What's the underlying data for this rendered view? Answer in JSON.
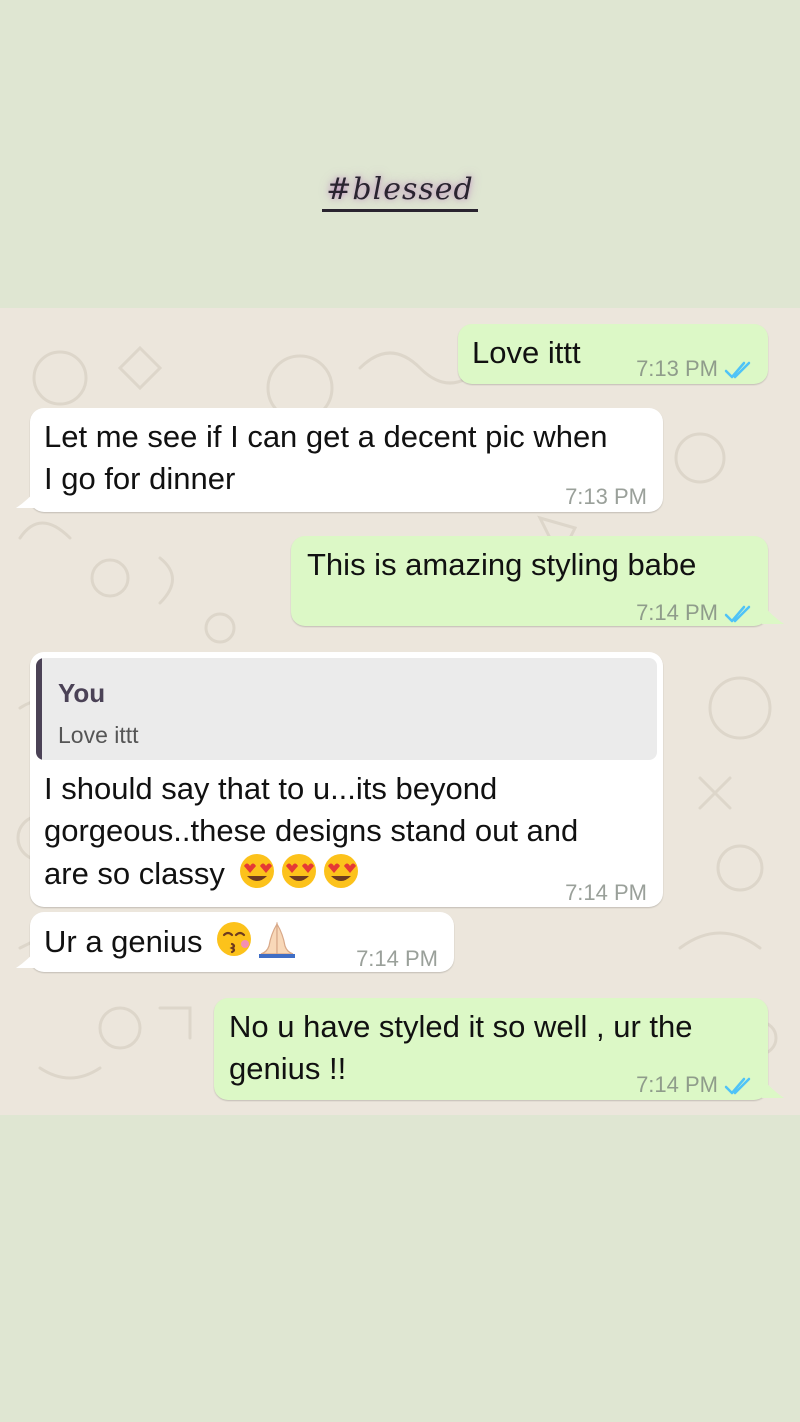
{
  "story": {
    "caption": "#blessed",
    "colors": {
      "background": "#dfe6d2"
    }
  },
  "chat": {
    "colors": {
      "outgoing_bubble": "#dcf8c6",
      "incoming_bubble": "#ffffff",
      "wallpaper": "#ece6dc",
      "read_ticks": "#4fc3f7"
    },
    "messages": [
      {
        "direction": "outgoing",
        "text": "Love ittt",
        "time": "7:13 PM",
        "status": "read-ticks-icon"
      },
      {
        "direction": "incoming",
        "text_line1": "Let me see if I can get a decent pic when",
        "text_line2": "I go for dinner",
        "time": "7:13 PM"
      },
      {
        "direction": "outgoing",
        "text": "This is amazing styling babe",
        "time": "7:14 PM",
        "status": "read-ticks-icon"
      },
      {
        "direction": "incoming",
        "quoted": {
          "author": "You",
          "text": "Love ittt"
        },
        "text_line1": "I should say that to u...its beyond",
        "text_line2": "gorgeous..these designs stand out and",
        "text_line3": "are so classy",
        "emojis": [
          "heart-eyes-emoji",
          "heart-eyes-emoji",
          "heart-eyes-emoji"
        ],
        "time": "7:14 PM"
      },
      {
        "direction": "incoming",
        "text": "Ur a genius",
        "emojis": [
          "kissing-face-emoji",
          "folded-hands-emoji"
        ],
        "time": "7:14 PM"
      },
      {
        "direction": "outgoing",
        "text_line1": "No u have styled it so well , ur the",
        "text_line2": "genius !!",
        "time": "7:14 PM",
        "status": "read-ticks-icon"
      }
    ]
  }
}
